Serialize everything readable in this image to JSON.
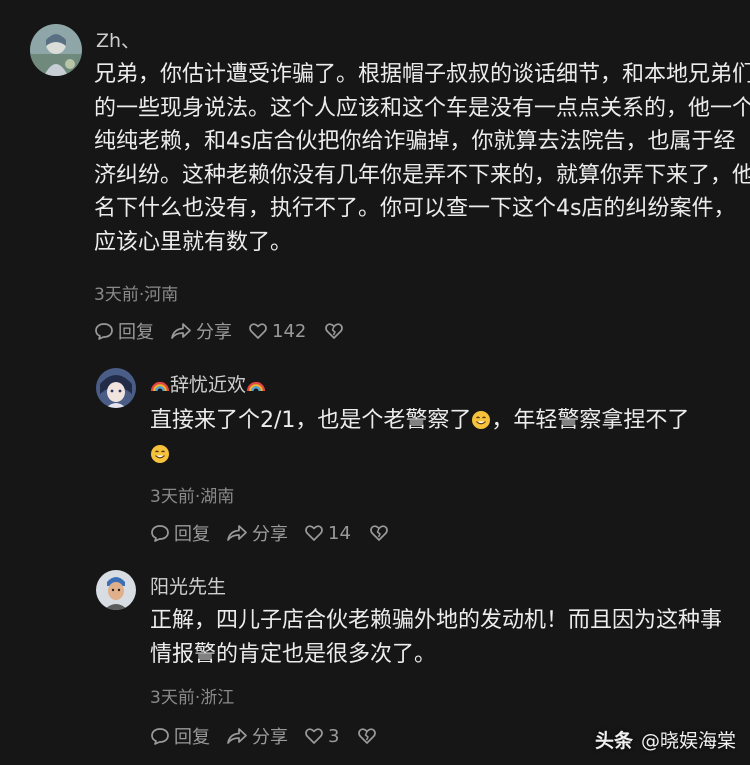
{
  "comments": [
    {
      "username": "Zh、",
      "text": "兄弟，你估计遭受诈骗了。根据帽子叔叔的谈话细节，和本地兄弟们的一些现身说法。这个人应该和这个车是没有一点点关系的，他一个纯纯老赖，和4s店合伙把你给诈骗掉，你就算去法院告，也属于经济纠纷。这种老赖你没有几年你是弄不下来的，就算你弄下来了，他名下什么也没有，执行不了。你可以查一下这个4s店的纠纷案件，应该心里就有数了。",
      "meta": "3天前·河南",
      "reply_label": "回复",
      "share_label": "分享",
      "likes": "142"
    },
    {
      "username": "辞忧近欢",
      "text_a": "直接来了个2/1，也是个老警察了",
      "text_b": "，年轻警察拿捏不了",
      "meta": "3天前·湖南",
      "reply_label": "回复",
      "share_label": "分享",
      "likes": "14"
    },
    {
      "username": "阳光先生",
      "text": "正解，四儿子店合伙老赖骗外地的发动机！而且因为这种事情报警的肯定也是很多次了。",
      "meta": "3天前·浙江",
      "reply_label": "回复",
      "share_label": "分享",
      "likes": "3"
    }
  ],
  "watermark": {
    "brand": "头条",
    "account": "@晓娱海棠"
  }
}
